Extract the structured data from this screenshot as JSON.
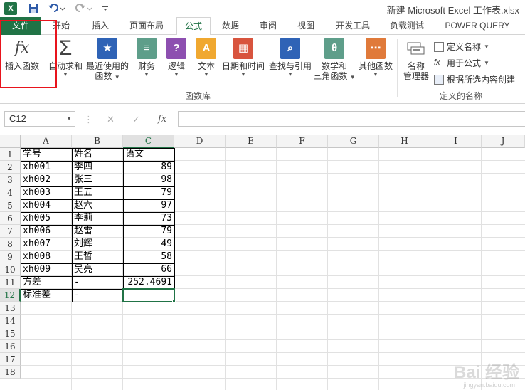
{
  "titlebar": {
    "logo": "X",
    "title": "新建 Microsoft Excel 工作表.xlsx"
  },
  "tabs": [
    {
      "label": "文件"
    },
    {
      "label": "开始"
    },
    {
      "label": "插入"
    },
    {
      "label": "页面布局"
    },
    {
      "label": "公式"
    },
    {
      "label": "数据"
    },
    {
      "label": "审阅"
    },
    {
      "label": "视图"
    },
    {
      "label": "开发工具"
    },
    {
      "label": "负载测试"
    },
    {
      "label": "POWER QUERY"
    }
  ],
  "ribbon": {
    "insert_function": "插入函数",
    "autosum": "自动求和",
    "recent_1": "最近使用的",
    "recent_2": "函数",
    "financial": "财务",
    "logical": "逻辑",
    "text": "文本",
    "datetime": "日期和时间",
    "lookup": "查找与引用",
    "math_1": "数学和",
    "math_2": "三角函数",
    "more": "其他函数",
    "library_group": "函数库",
    "name_mgr_1": "名称",
    "name_mgr_2": "管理器",
    "define_name": "定义名称",
    "use_in_formula": "用于公式",
    "create_from_sel": "根据所选内容创建",
    "names_group": "定义的名称"
  },
  "formula_bar": {
    "name_box": "C12",
    "cancel": "✕",
    "enter": "✓",
    "fx": "fx",
    "formula": ""
  },
  "columns": [
    "A",
    "B",
    "C",
    "D",
    "E",
    "F",
    "G",
    "H",
    "I",
    "J"
  ],
  "rows": [
    "1",
    "2",
    "3",
    "4",
    "5",
    "6",
    "7",
    "8",
    "9",
    "10",
    "11",
    "12",
    "13",
    "14",
    "15",
    "16",
    "17",
    "18"
  ],
  "sheet": {
    "header": {
      "a": "学号",
      "b": "姓名",
      "c": "语文"
    },
    "data": [
      {
        "a": "xh001",
        "b": "李四",
        "c": "89"
      },
      {
        "a": "xh002",
        "b": "张三",
        "c": "98"
      },
      {
        "a": "xh003",
        "b": "王五",
        "c": "79"
      },
      {
        "a": "xh004",
        "b": "赵六",
        "c": "97"
      },
      {
        "a": "xh005",
        "b": "李莉",
        "c": "73"
      },
      {
        "a": "xh006",
        "b": "赵雷",
        "c": "79"
      },
      {
        "a": "xh007",
        "b": "刘辉",
        "c": "49"
      },
      {
        "a": "xh008",
        "b": "王哲",
        "c": "58"
      },
      {
        "a": "xh009",
        "b": "吴亮",
        "c": "66"
      }
    ],
    "variance": {
      "a": "方差",
      "b": "-",
      "c": "252.4691"
    },
    "stdev": {
      "a": "标准差",
      "b": "-",
      "c": ""
    }
  },
  "watermark": {
    "text": "Bai 经验",
    "sub": "jingyan.baidu.com"
  }
}
